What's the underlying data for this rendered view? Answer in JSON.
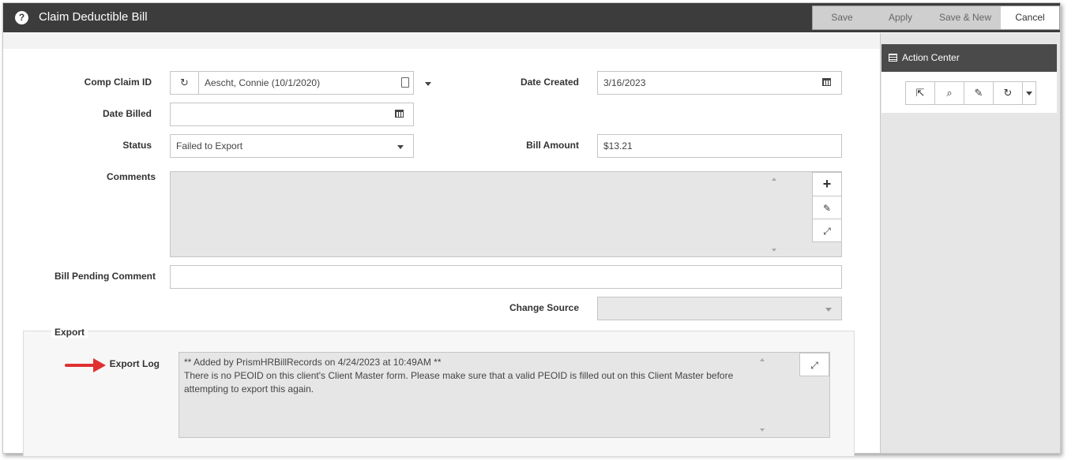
{
  "window": {
    "title": "Claim Deductible Bill"
  },
  "toolbar": {
    "save": "Save",
    "apply": "Apply",
    "save_new": "Save & New",
    "cancel": "Cancel"
  },
  "form": {
    "comp_claim_id": {
      "label": "Comp Claim ID",
      "value": "Aescht, Connie (10/1/2020)"
    },
    "date_created": {
      "label": "Date Created",
      "value": "3/16/2023"
    },
    "date_billed": {
      "label": "Date Billed",
      "value": ""
    },
    "status": {
      "label": "Status",
      "value": "Failed to Export"
    },
    "bill_amount": {
      "label": "Bill Amount",
      "value": "$13.21"
    },
    "comments": {
      "label": "Comments",
      "value": ""
    },
    "bill_pending_comment": {
      "label": "Bill Pending Comment",
      "value": ""
    },
    "change_source": {
      "label": "Change Source",
      "value": ""
    }
  },
  "export": {
    "section_title": "Export",
    "log_label": "Export Log",
    "log_lines": [
      "** Added by PrismHRBillRecords on 4/24/2023 at 10:49AM **",
      "There is no PEOID on this client's Client Master form. Please make sure that a valid PEOID is filled out on this Client Master before attempting to export this again."
    ]
  },
  "action_center": {
    "title": "Action Center"
  },
  "colors": {
    "titlebar": "#3c3c3c",
    "annotation_arrow": "#e03030",
    "panel": "#e6e6e6"
  }
}
